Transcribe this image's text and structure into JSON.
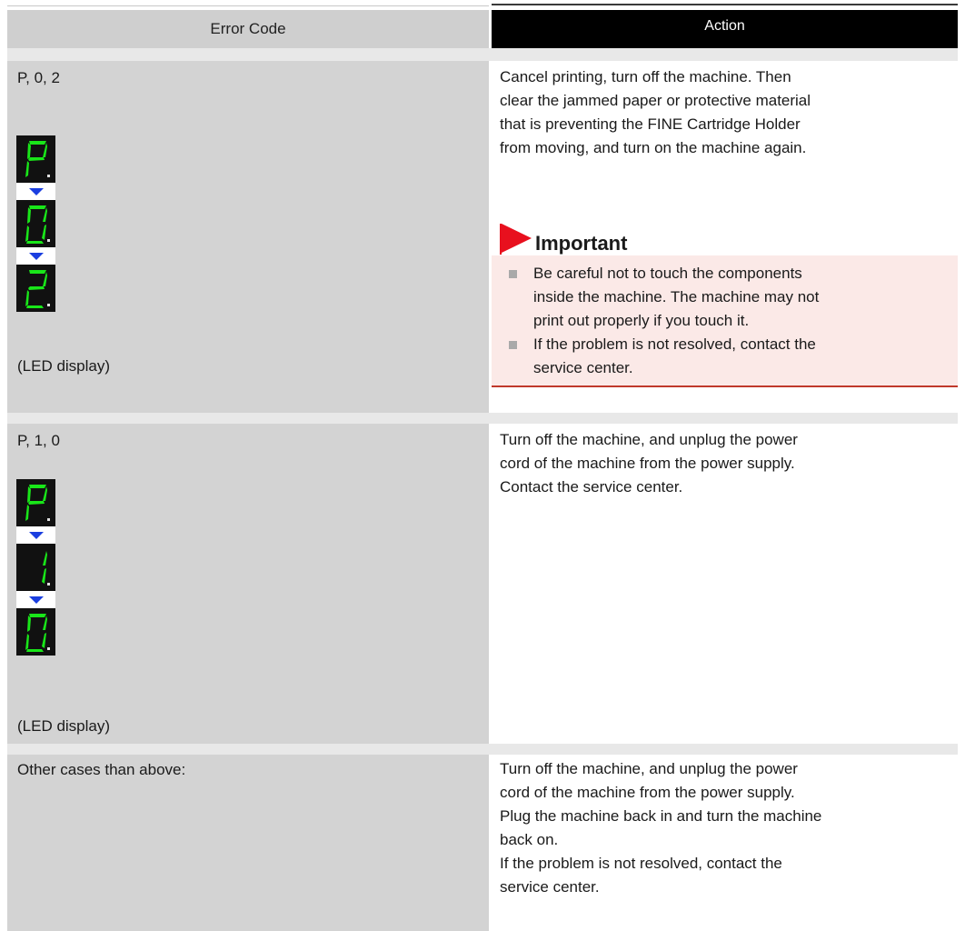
{
  "table": {
    "header": {
      "col_error": "Error Code",
      "col_action": "Action"
    },
    "rows": [
      {
        "code": "P, 0, 2",
        "led_digits": [
          "P",
          "0",
          "2"
        ],
        "led_caption": "(LED display)",
        "action": [
          "Cancel printing, turn off the machine. Then",
          "clear the jammed paper or protective material",
          "that is preventing the FINE Cartridge Holder",
          "from moving, and turn on the machine again."
        ],
        "important": {
          "title": "Important",
          "items": [
            [
              "Be careful not to touch the components",
              "inside the machine. The machine may not",
              "print out properly if you touch it."
            ],
            [
              "If the problem is not resolved, contact the",
              "service center."
            ]
          ]
        }
      },
      {
        "code": "P, 1, 0",
        "led_digits": [
          "P",
          "1",
          "0"
        ],
        "led_caption": "(LED display)",
        "action": [
          "Turn off the machine, and unplug the power",
          "cord of the machine from the power supply.",
          "Contact the service center."
        ]
      },
      {
        "code": "Other cases than above:",
        "action": [
          "Turn off the machine, and unplug the power",
          "cord of the machine from the power supply.",
          "Plug the machine back in and turn the machine",
          "back on.",
          "If the problem is not resolved, contact the",
          "service center."
        ]
      }
    ]
  },
  "colors": {
    "led_segment": "#19e619",
    "led_background": "#111111",
    "arrow": "#1a3ee0",
    "important_flag": "#e8101e",
    "important_background": "#fbe9e7",
    "important_border": "#c0392b"
  },
  "icons": {
    "led_arrow": "triangle-down-icon",
    "important_flag": "red-flag-icon",
    "bullet": "square-bullet-icon"
  }
}
